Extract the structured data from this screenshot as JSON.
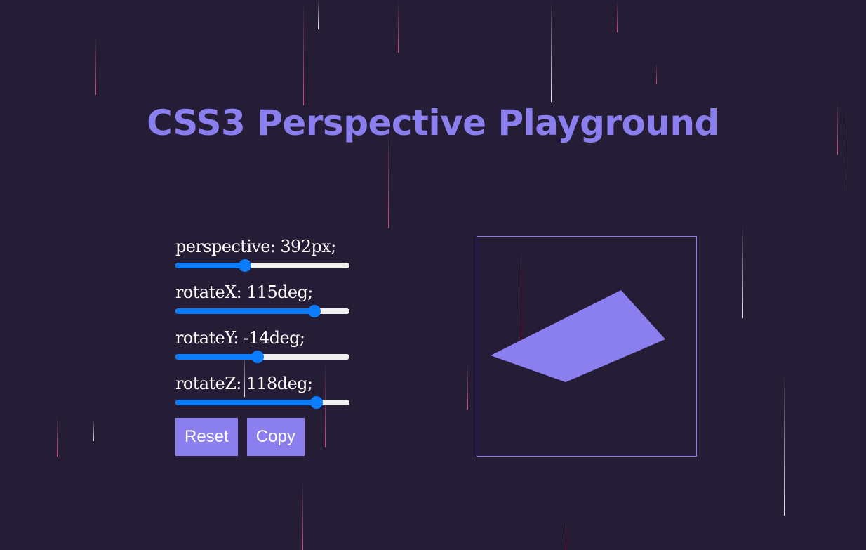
{
  "title": "CSS3 Perspective Playground",
  "controls": [
    {
      "label": "perspective: 392px;",
      "value": 0.4
    },
    {
      "label": "rotateX: 115deg;",
      "value": 0.8
    },
    {
      "label": "rotateY: -14deg;",
      "value": 0.47
    },
    {
      "label": "rotateZ: 118deg;",
      "value": 0.81
    }
  ],
  "buttons": {
    "reset_label": "Reset",
    "copy_label": "Copy"
  },
  "colors": {
    "background": "#251d36",
    "accent": "#8b7ff0",
    "slider": "#0b7cfb",
    "track": "#efefef"
  }
}
